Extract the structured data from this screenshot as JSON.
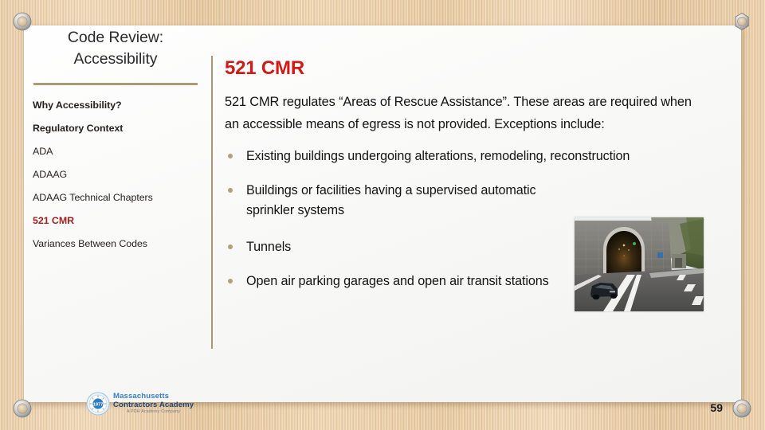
{
  "slide": {
    "page_number": "59"
  },
  "sidebar": {
    "title_line1": "Code Review:",
    "title_line2": "Accessibility",
    "items": [
      {
        "label": "Why Accessibility?",
        "style": "bold"
      },
      {
        "label": "Regulatory Context",
        "style": "bold"
      },
      {
        "label": "ADA",
        "style": "normal"
      },
      {
        "label": "ADAAG",
        "style": "normal"
      },
      {
        "label": "ADAAG Technical Chapters",
        "style": "normal"
      },
      {
        "label": "521 CMR",
        "style": "active"
      },
      {
        "label": "Variances Between Codes",
        "style": "normal"
      }
    ]
  },
  "content": {
    "heading": "521 CMR",
    "intro": "521 CMR regulates “Areas of Rescue Assistance”.  These areas are required when an accessible means of egress is not provided. Exceptions include:",
    "bullets": [
      "Existing buildings undergoing alterations, remodeling, reconstruction",
      "Buildings or facilities having a supervised automatic sprinkler systems",
      "Tunnels",
      "Open air parking garages and open air transit stations"
    ]
  },
  "logo": {
    "line1": "Massachusetts",
    "line2": "Contractors Academy",
    "tagline": "A PDH Academy Company",
    "mark_text": "1977"
  },
  "colors": {
    "heading_red": "#cf1a17",
    "sidebar_active_red": "#9e2020",
    "divider_tan": "#ab9873",
    "bullet_tan": "#b3a179",
    "background_wood": "#e6c79b",
    "slide_white": "#fbfbfa"
  },
  "media": {
    "photo_caption": "tunnel-entrance-photo"
  }
}
